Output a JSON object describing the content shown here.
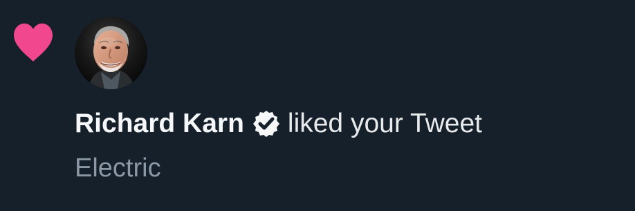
{
  "notification": {
    "type_icon": "heart-icon",
    "user": {
      "avatar": "user-avatar",
      "name": "Richard Karn",
      "verified_icon": "verified-badge-icon"
    },
    "action_text": "liked your Tweet",
    "tweet_preview": "Electric"
  },
  "colors": {
    "background": "#16202b",
    "heart": "#f0478f",
    "primary_text": "#e8eaec",
    "secondary_text": "#8b98a5",
    "verified_badge": "#f5f7f9"
  }
}
